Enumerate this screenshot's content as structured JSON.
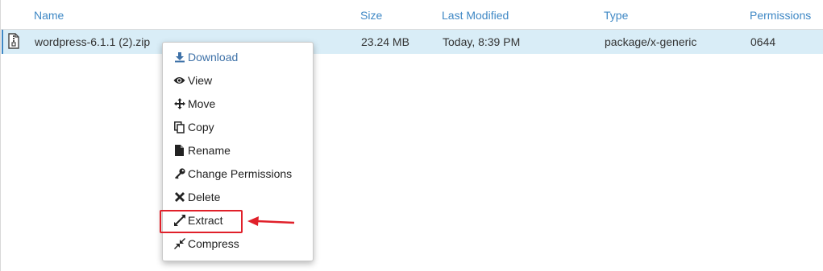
{
  "table": {
    "columns": [
      "Name",
      "Size",
      "Last Modified",
      "Type",
      "Permissions"
    ],
    "rows": [
      {
        "name": "wordpress-6.1.1 (2).zip",
        "size": "23.24 MB",
        "last_modified": "Today, 8:39 PM",
        "type": "package/x-generic",
        "permissions": "0644",
        "icon": "zip-file-icon"
      }
    ]
  },
  "context_menu": {
    "items": [
      {
        "label": "Download",
        "icon": "download-icon"
      },
      {
        "label": "View",
        "icon": "eye-icon"
      },
      {
        "label": "Move",
        "icon": "move-icon"
      },
      {
        "label": "Copy",
        "icon": "copy-icon"
      },
      {
        "label": "Rename",
        "icon": "file-icon"
      },
      {
        "label": "Change Permissions",
        "icon": "key-icon"
      },
      {
        "label": "Delete",
        "icon": "close-icon"
      },
      {
        "label": "Extract",
        "icon": "expand-icon"
      },
      {
        "label": "Compress",
        "icon": "compress-icon"
      }
    ]
  },
  "colors": {
    "header_link": "#3f88c5",
    "row_selected": "#d9edf7",
    "annotation_red": "#e0202a"
  }
}
